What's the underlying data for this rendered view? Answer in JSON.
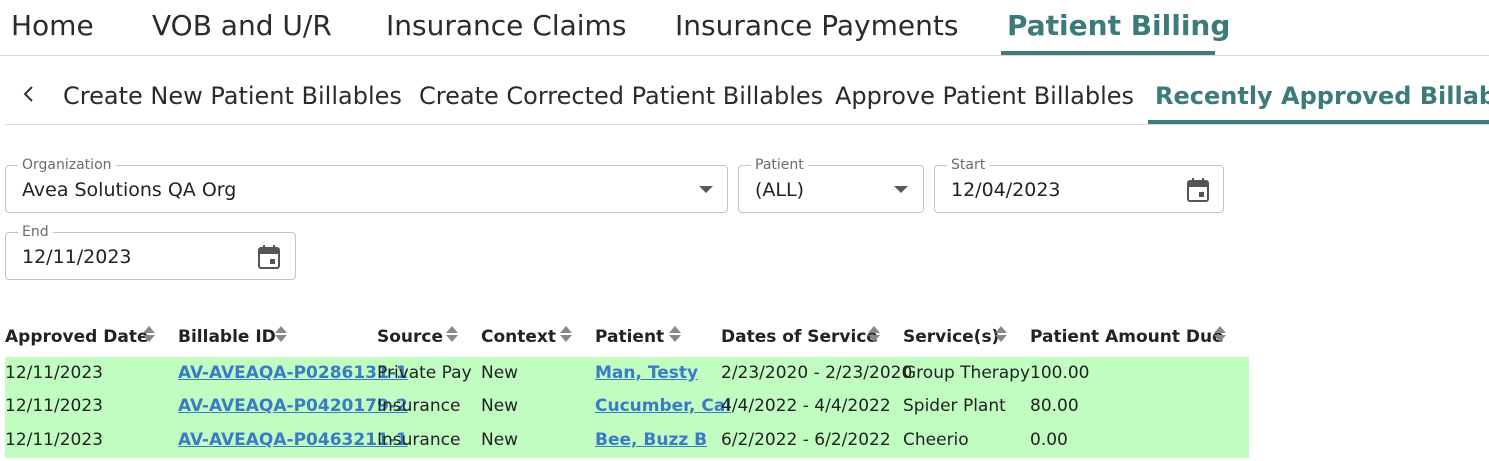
{
  "top_nav": {
    "tabs": [
      {
        "label": "Home"
      },
      {
        "label": "VOB and U/R"
      },
      {
        "label": "Insurance Claims"
      },
      {
        "label": "Insurance Payments"
      },
      {
        "label": "Patient Billing",
        "active": true
      }
    ]
  },
  "sub_nav": {
    "back_icon": "chevron-left-icon",
    "tabs": [
      {
        "label": "Create New Patient Billables"
      },
      {
        "label": "Create Corrected Patient Billables"
      },
      {
        "label": "Approve Patient Billables"
      },
      {
        "label": "Recently Approved Billables",
        "active": true
      }
    ]
  },
  "filters": {
    "organization": {
      "label": "Organization",
      "value": "Avea Solutions QA Org"
    },
    "patient": {
      "label": "Patient",
      "value": "(ALL)"
    },
    "start": {
      "label": "Start",
      "value": "12/04/2023"
    },
    "end": {
      "label": "End",
      "value": "12/11/2023"
    }
  },
  "table": {
    "columns": [
      "Approved Date",
      "Billable ID",
      "Source",
      "Context",
      "Patient",
      "Dates of Service",
      "Service(s)",
      "Patient Amount Due"
    ],
    "rows": [
      [
        "12/11/2023",
        "AV-AVEAQA-P0286131-1",
        "Private Pay",
        "New",
        "Man, Testy",
        "2/23/2020 - 2/23/2020",
        "Group Therapy",
        "100.00"
      ],
      [
        "12/11/2023",
        "AV-AVEAQA-P0420179-2",
        "Insurance",
        "New",
        "Cucumber, Cal",
        "4/4/2022 - 4/4/2022",
        "Spider Plant",
        "80.00"
      ],
      [
        "12/11/2023",
        "AV-AVEAQA-P0463211-1",
        "Insurance",
        "New",
        "Bee, Buzz B",
        "6/2/2022 - 6/2/2022",
        "Cheerio",
        "0.00"
      ]
    ]
  },
  "colors": {
    "accent": "#3d7b7b",
    "link": "#3a7bc8",
    "row_highlight": "#c1fcc1"
  }
}
